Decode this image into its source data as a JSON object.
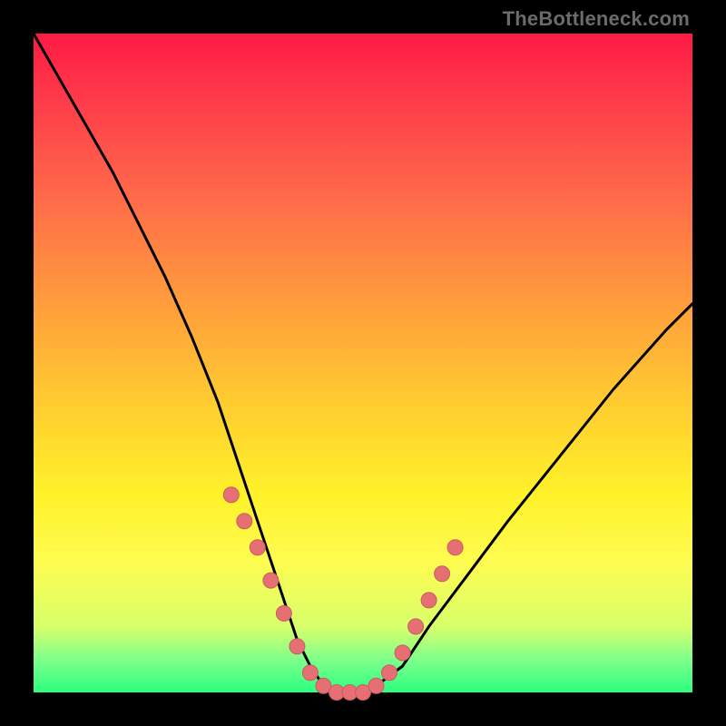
{
  "watermark": "TheBottleneck.com",
  "colors": {
    "frame": "#000000",
    "curve": "#000000",
    "marker_fill": "#e56f73",
    "marker_stroke": "#c95d60",
    "gradient_top": "#ff1a45",
    "gradient_bottom": "#2bff7f"
  },
  "chart_data": {
    "type": "line",
    "title": "",
    "xlabel": "",
    "ylabel": "",
    "xlim": [
      0,
      100
    ],
    "ylim": [
      0,
      100
    ],
    "series": [
      {
        "name": "bottleneck-curve",
        "x": [
          0,
          4,
          8,
          12,
          16,
          20,
          24,
          26,
          28,
          30,
          32,
          34,
          36,
          38,
          40,
          42,
          44,
          46,
          48,
          50,
          52,
          56,
          60,
          66,
          72,
          80,
          88,
          96,
          100
        ],
        "y": [
          100,
          93,
          86,
          79,
          71,
          63,
          54,
          49,
          44,
          38,
          32,
          26,
          20,
          14,
          8,
          4,
          1,
          0,
          0,
          0,
          1,
          4,
          10,
          18,
          26,
          36,
          46,
          55,
          59
        ]
      }
    ],
    "markers": {
      "name": "highlight-points",
      "points": [
        {
          "x": 30,
          "y": 30
        },
        {
          "x": 32,
          "y": 26
        },
        {
          "x": 34,
          "y": 22
        },
        {
          "x": 36,
          "y": 17
        },
        {
          "x": 38,
          "y": 12
        },
        {
          "x": 40,
          "y": 7
        },
        {
          "x": 42,
          "y": 3
        },
        {
          "x": 44,
          "y": 1
        },
        {
          "x": 46,
          "y": 0
        },
        {
          "x": 48,
          "y": 0
        },
        {
          "x": 50,
          "y": 0
        },
        {
          "x": 52,
          "y": 1
        },
        {
          "x": 54,
          "y": 3
        },
        {
          "x": 56,
          "y": 6
        },
        {
          "x": 58,
          "y": 10
        },
        {
          "x": 60,
          "y": 14
        },
        {
          "x": 62,
          "y": 18
        },
        {
          "x": 64,
          "y": 22
        }
      ]
    }
  }
}
